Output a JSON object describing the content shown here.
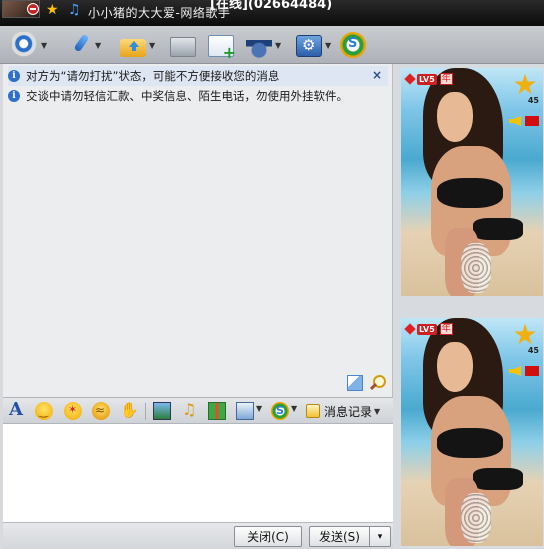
{
  "title_bar": {
    "name_top": "[在线](02664484)",
    "signature": "小小猪的大大爱-网络歌手"
  },
  "toolbar": {
    "icons": [
      "video-call-icon",
      "voice-call-icon",
      "send-file-icon",
      "remote-desktop-icon",
      "create-group-icon",
      "apps-icon",
      "settings-icon",
      "soso-icon"
    ]
  },
  "chat": {
    "notice_dnd": "对方为“请勿打扰”状态，可能不方便接收您的消息",
    "notice_safety": "交谈中请勿轻信汇款、中奖信息、陌生电话，勿使用外挂软件。",
    "close_symbol": "×"
  },
  "input_toolbar": {
    "font_label": "A",
    "history_label": "消息记录"
  },
  "bottom": {
    "close_label": "关闭(C)",
    "send_label": "发送(S)",
    "send_caret": "▾"
  },
  "right_panel": {
    "level_text": "LV5",
    "year_text": "年",
    "star_count": "45",
    "star_glyph": "★"
  }
}
